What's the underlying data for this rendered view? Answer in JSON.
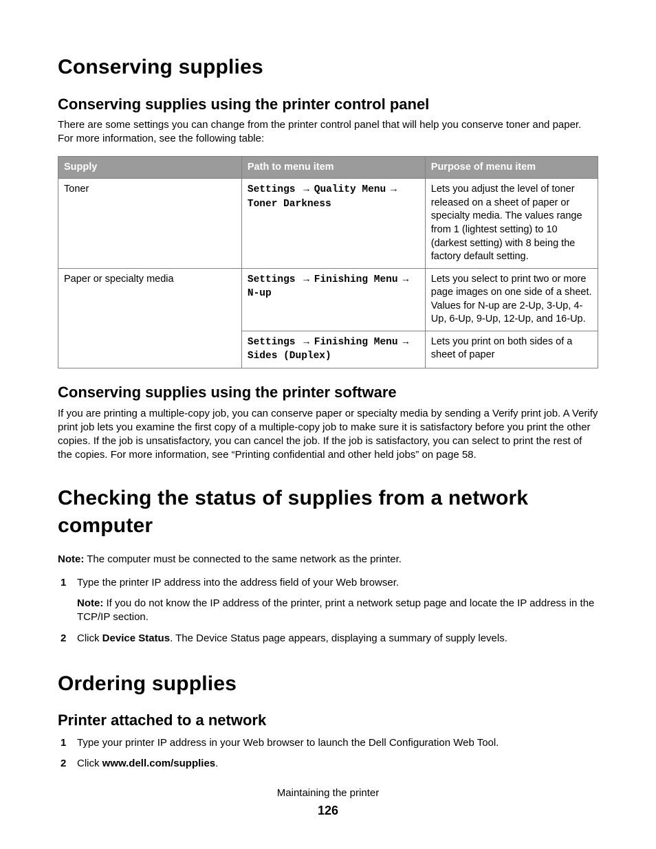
{
  "s1": {
    "h": "Conserving supplies",
    "sub1": {
      "h": "Conserving supplies using the printer control panel",
      "p": "There are some settings you can change from the printer control panel that will help you conserve toner and paper. For more information, see the following table:",
      "table": {
        "head": {
          "c1": "Supply",
          "c2": "Path to menu item",
          "c3": "Purpose of menu item"
        },
        "rows": [
          {
            "supply": "Toner",
            "path_pre": "Settings ",
            "path_mid1": "Quality Menu",
            "path_end": "Toner Darkness",
            "purpose": "Lets you adjust the level of toner released on a sheet of paper or specialty media. The values range from 1 (lightest setting) to 10 (darkest setting) with 8 being the factory default setting."
          },
          {
            "supply": "Paper or specialty media",
            "path_pre": "Settings ",
            "path_mid1": "Finishing Menu",
            "path_end": "N-up",
            "purpose": "Lets you select to print two or more page images on one side of a sheet. Values for N-up are 2-Up, 3-Up, 4-Up, 6-Up, 9-Up, 12-Up, and 16-Up."
          },
          {
            "supply": "",
            "path_pre": "Settings ",
            "path_mid1": "Finishing Menu",
            "path_end": "Sides (Duplex)",
            "purpose": "Lets you print on both sides of a sheet of paper"
          }
        ]
      }
    },
    "sub2": {
      "h": "Conserving supplies using the printer software",
      "p": "If you are printing a multiple-copy job, you can conserve paper or specialty media by sending a Verify print job. A Verify print job lets you examine the first copy of a multiple-copy job to make sure it is satisfactory before you print the other copies. If the job is unsatisfactory, you can cancel the job. If the job is satisfactory, you can select to print the rest of the copies. For more information, see “Printing confidential and other held jobs” on page 58."
    }
  },
  "s2": {
    "h": "Checking the status of supplies from a network computer",
    "note_label": "Note:",
    "note_text": " The computer must be connected to the same network as the printer.",
    "steps": {
      "n1": "1",
      "t1": "Type the printer IP address into the address field of your Web browser.",
      "sub_note_label": "Note:",
      "sub_note_text": " If you do not know the IP address of the printer, print a network setup page and locate the IP address in the TCP/IP section.",
      "n2": "2",
      "t2_pre": "Click ",
      "t2_bold": "Device Status",
      "t2_post": ". The Device Status page appears, displaying a summary of supply levels."
    }
  },
  "s3": {
    "h": "Ordering supplies",
    "sub1": {
      "h": "Printer attached to a network",
      "steps": {
        "n1": "1",
        "t1": "Type your printer IP address in your Web browser to launch the Dell Configuration Web Tool.",
        "n2": "2",
        "t2_pre": "Click ",
        "t2_bold": "www.dell.com/supplies",
        "t2_post": "."
      }
    }
  },
  "footer": {
    "line1": "Maintaining the printer",
    "line2": "126"
  },
  "arrow": " → "
}
